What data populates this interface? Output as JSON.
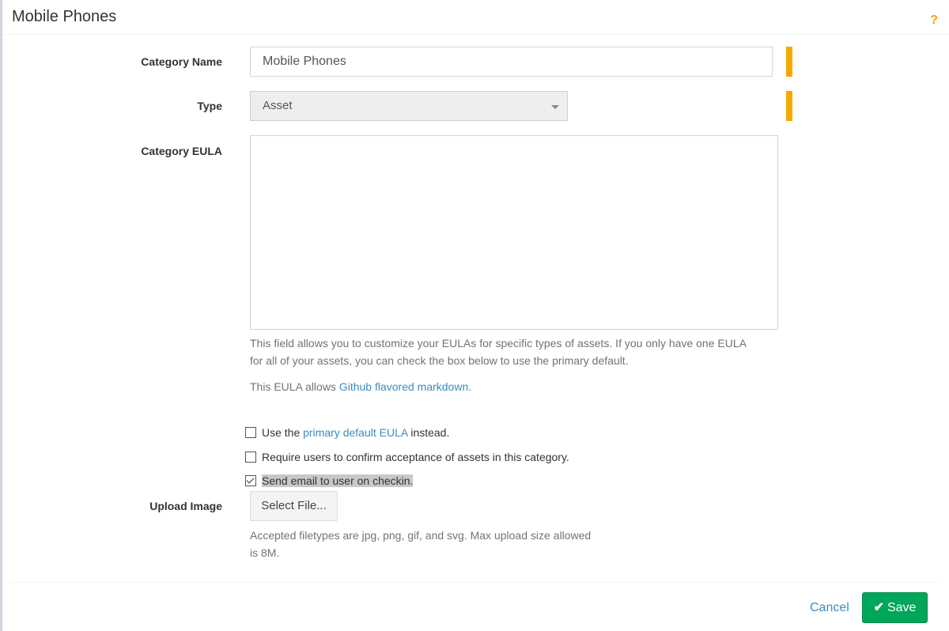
{
  "header": {
    "title": "Mobile Phones",
    "help_icon": "?"
  },
  "form": {
    "category_name": {
      "label": "Category Name",
      "value": "Mobile Phones"
    },
    "type": {
      "label": "Type",
      "value": "Asset"
    },
    "eula": {
      "label": "Category EULA",
      "value": "",
      "help_line1": "This field allows you to customize your EULAs for specific types of assets. If you only have one EULA",
      "help_line2": "for all of your assets, you can check the box below to use the primary default.",
      "markdown_prefix": "This EULA allows ",
      "markdown_link": "Github flavored markdown",
      "markdown_suffix": "."
    },
    "checkboxes": {
      "use_default": {
        "prefix": "Use the ",
        "link": "primary default EULA",
        "suffix": " instead.",
        "checked": false
      },
      "require_acceptance": {
        "label": "Require users to confirm acceptance of assets in this category.",
        "checked": false
      },
      "email_checkin": {
        "label": "Send email to user on checkin.",
        "checked": true
      }
    },
    "upload": {
      "label": "Upload Image",
      "button": "Select File...",
      "help_line1": "Accepted filetypes are jpg, png, gif, and svg. Max upload size allowed",
      "help_line2": "is 8M."
    }
  },
  "footer": {
    "cancel": "Cancel",
    "save": "Save",
    "save_icon": "✔"
  },
  "colors": {
    "required_bar": "#f7a800",
    "link": "#3c8dbc",
    "save_button": "#00a65a",
    "help_icon": "#f39c12"
  }
}
